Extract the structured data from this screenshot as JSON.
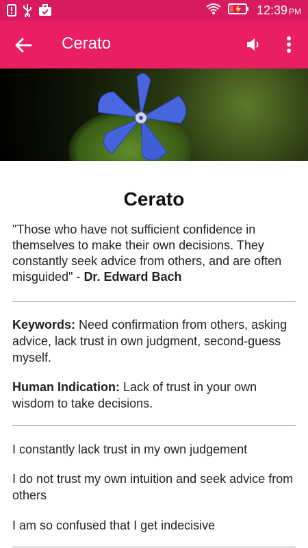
{
  "status_bar": {
    "time": "12:39",
    "ampm": "PM",
    "icons": [
      "notification-icon",
      "usb-icon",
      "briefcase-icon",
      "wifi-icon",
      "battery-charging-icon"
    ]
  },
  "app_bar": {
    "title": "Cerato",
    "back_icon": "arrow-back-icon",
    "volume_icon": "volume-icon",
    "more_icon": "more-vert-icon"
  },
  "content": {
    "title": "Cerato",
    "quote": "\"Those who have not sufficient confidence in themselves to make their own decisions. They constantly seek advice from others, and are often misguided\" - ",
    "quote_author": "Dr. Edward Bach",
    "keywords_label": "Keywords:",
    "keywords_text": " Need confirmation from others, asking advice, lack trust in own judgment, second-guess myself.",
    "indication_label": "Human Indication:",
    "indication_text": " Lack of trust in your own wisdom to take decisions.",
    "statements": [
      "I constantly lack trust in my own judgement",
      "I do not trust my own intuition and seek advice from others",
      "I am so confused that I get indecisive"
    ]
  },
  "colors": {
    "status_bar": "#d81b60",
    "app_bar": "#e91e63",
    "flower": "#3f5fd8"
  }
}
